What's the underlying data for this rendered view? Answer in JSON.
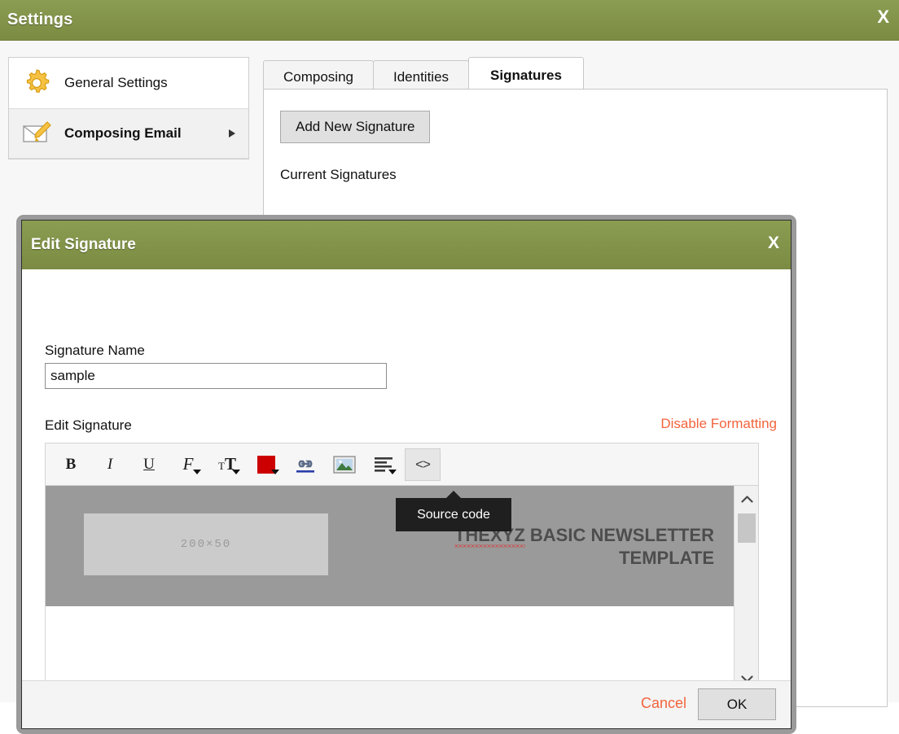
{
  "header": {
    "title": "Settings",
    "close_label": "X"
  },
  "sidebar": {
    "items": [
      {
        "label": "General Settings",
        "icon": "gear-icon",
        "selected": false
      },
      {
        "label": "Composing Email",
        "icon": "envelope-pencil-icon",
        "selected": true
      }
    ]
  },
  "tabs": [
    {
      "label": "Composing",
      "active": false
    },
    {
      "label": "Identities",
      "active": false
    },
    {
      "label": "Signatures",
      "active": true
    }
  ],
  "signatures_panel": {
    "add_button": "Add New Signature",
    "current_heading": "Current Signatures"
  },
  "modal": {
    "title": "Edit Signature",
    "close_label": "X",
    "name_label": "Signature Name",
    "name_value": "sample",
    "name_placeholder": "Signature Name",
    "editor_label": "Edit Signature",
    "disable_formatting": "Disable Formatting",
    "toolbar": [
      {
        "name": "bold-icon",
        "glyph": "B",
        "has_caret": false,
        "active": false
      },
      {
        "name": "italic-icon",
        "glyph": "I",
        "has_caret": false,
        "active": false
      },
      {
        "name": "underline-icon",
        "glyph": "U",
        "has_caret": false,
        "active": false
      },
      {
        "name": "font-family-icon",
        "glyph": "F",
        "has_caret": true,
        "active": false
      },
      {
        "name": "font-size-icon",
        "glyph": "TT",
        "has_caret": true,
        "active": false
      },
      {
        "name": "text-color-icon",
        "glyph": "",
        "has_caret": true,
        "active": false
      },
      {
        "name": "insert-link-icon",
        "glyph": "",
        "has_caret": false,
        "active": false
      },
      {
        "name": "insert-image-icon",
        "glyph": "",
        "has_caret": false,
        "active": false
      },
      {
        "name": "align-text-icon",
        "glyph": "",
        "has_caret": true,
        "active": false
      },
      {
        "name": "source-code-icon",
        "glyph": "<>",
        "has_caret": false,
        "active": true
      }
    ],
    "tooltip": "Source code",
    "content": {
      "image_placeholder": "200×50",
      "headline_misspelled": "THEXYZ",
      "headline_rest": " BASIC NEWSLETTER TEMPLATE"
    },
    "scrollbar": {
      "up": "⌃",
      "down": "⌄"
    },
    "cancel_label": "Cancel",
    "ok_label": "OK"
  },
  "colors": {
    "green_header": "#7b8b43",
    "accent_orange": "#f2643d",
    "swatch_red": "#cc0000",
    "banner_gray": "#9a9a9a"
  }
}
